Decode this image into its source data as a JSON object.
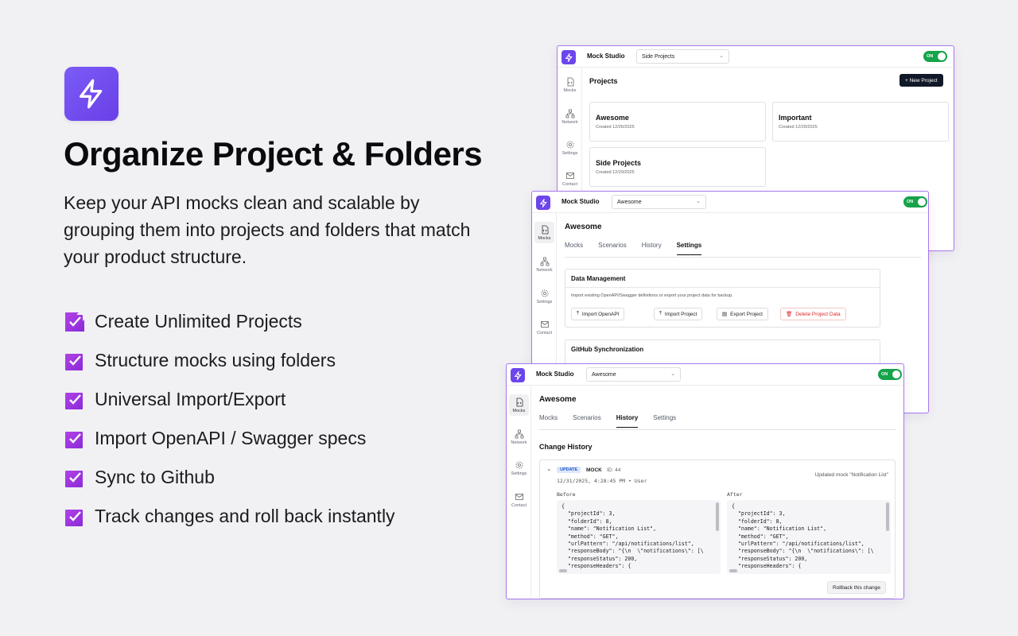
{
  "hero": {
    "headline": "Organize Project & Folders",
    "subtext": "Keep your API mocks clean and scalable by grouping them into projects and folders that match your product structure.",
    "features": [
      "Create Unlimited Projects",
      "Structure mocks using folders",
      "Universal Import/Export",
      "Import OpenAPI / Swagger specs",
      "Sync to Github",
      "Track changes and roll back instantly"
    ]
  },
  "colors": {
    "accent": "#6d45ec",
    "toggle_on": "#16a34a",
    "border": "#a778ee"
  },
  "app": {
    "title": "Mock Studio",
    "toggle_label": "ON",
    "nav": [
      "Mocks",
      "Network",
      "Settings",
      "Contact"
    ]
  },
  "win1": {
    "project_select": "Side Projects",
    "page_title": "Projects",
    "new_project_label": "+ New Project",
    "projects": [
      {
        "name": "Awesome",
        "created": "Created 12/26/2025"
      },
      {
        "name": "Important",
        "created": "Created 12/29/2025"
      },
      {
        "name": "Side Projects",
        "created": "Created 12/29/2025"
      }
    ]
  },
  "win2": {
    "project_select": "Awesome",
    "page_title": "Awesome",
    "tabs": [
      "Mocks",
      "Scenarios",
      "History",
      "Settings"
    ],
    "section1_title": "Data Management",
    "section1_desc": "Import existing OpenAPI/Swagger definitions or export your project data for backup.",
    "buttons": [
      "Import OpenAPI",
      "Import Project",
      "Export Project",
      "Delete Project Data"
    ],
    "section2_title": "GitHub Synchronization"
  },
  "win3": {
    "project_select": "Awesome",
    "page_title": "Awesome",
    "tabs": [
      "Mocks",
      "Scenarios",
      "History",
      "Settings"
    ],
    "section_title": "Change History",
    "entry": {
      "badge": "UPDATE",
      "type": "MOCK",
      "id": "ID: 44",
      "timestamp": "12/31/2025, 4:28:45 PM • User",
      "summary": "Updated mock \"Notification List\"",
      "before_label": "Before",
      "after_label": "After",
      "code": "{\n  \"projectId\": 3,\n  \"folderId\": 8,\n  \"name\": \"Notification List\",\n  \"method\": \"GET\",\n  \"urlPattern\": \"/api/notifications/list\",\n  \"responseBody\": \"{\\n  \\\"notifications\\\": [\\\n  \"responseStatus\": 200,\n  \"responseHeaders\": {",
      "rollback_label": "Rollback this change"
    }
  }
}
